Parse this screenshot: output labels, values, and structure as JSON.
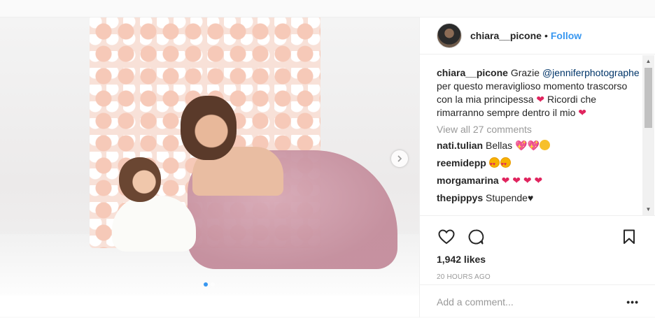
{
  "header": {
    "username": "chiara__picone",
    "separator": "•",
    "follow_label": "Follow"
  },
  "caption": {
    "username": "chiara__picone",
    "text_before": " Grazie ",
    "mention": "@jenniferphotographe",
    "text_after": " per questo meraviglioso momento trascorso con la mia principessa ",
    "text_after2": " Ricordi che rimarranno sempre dentro il mio "
  },
  "view_all": "View all 27 comments",
  "comments": [
    {
      "user": "nati.tulian",
      "text": " Bellas "
    },
    {
      "user": "reemidepp",
      "text": " "
    },
    {
      "user": "morgamarina",
      "text": " "
    },
    {
      "user": "thepippys",
      "text": " Stupende"
    }
  ],
  "actions": {
    "likes": "1,942 likes",
    "time": "20 HOURS AGO"
  },
  "add_comment": {
    "placeholder": "Add a comment...",
    "more": "•••"
  },
  "carousel": {
    "current_index": 1,
    "total": 2
  },
  "colors": {
    "accent": "#3897f0",
    "heart": "#e0245e",
    "mention": "#003569"
  }
}
